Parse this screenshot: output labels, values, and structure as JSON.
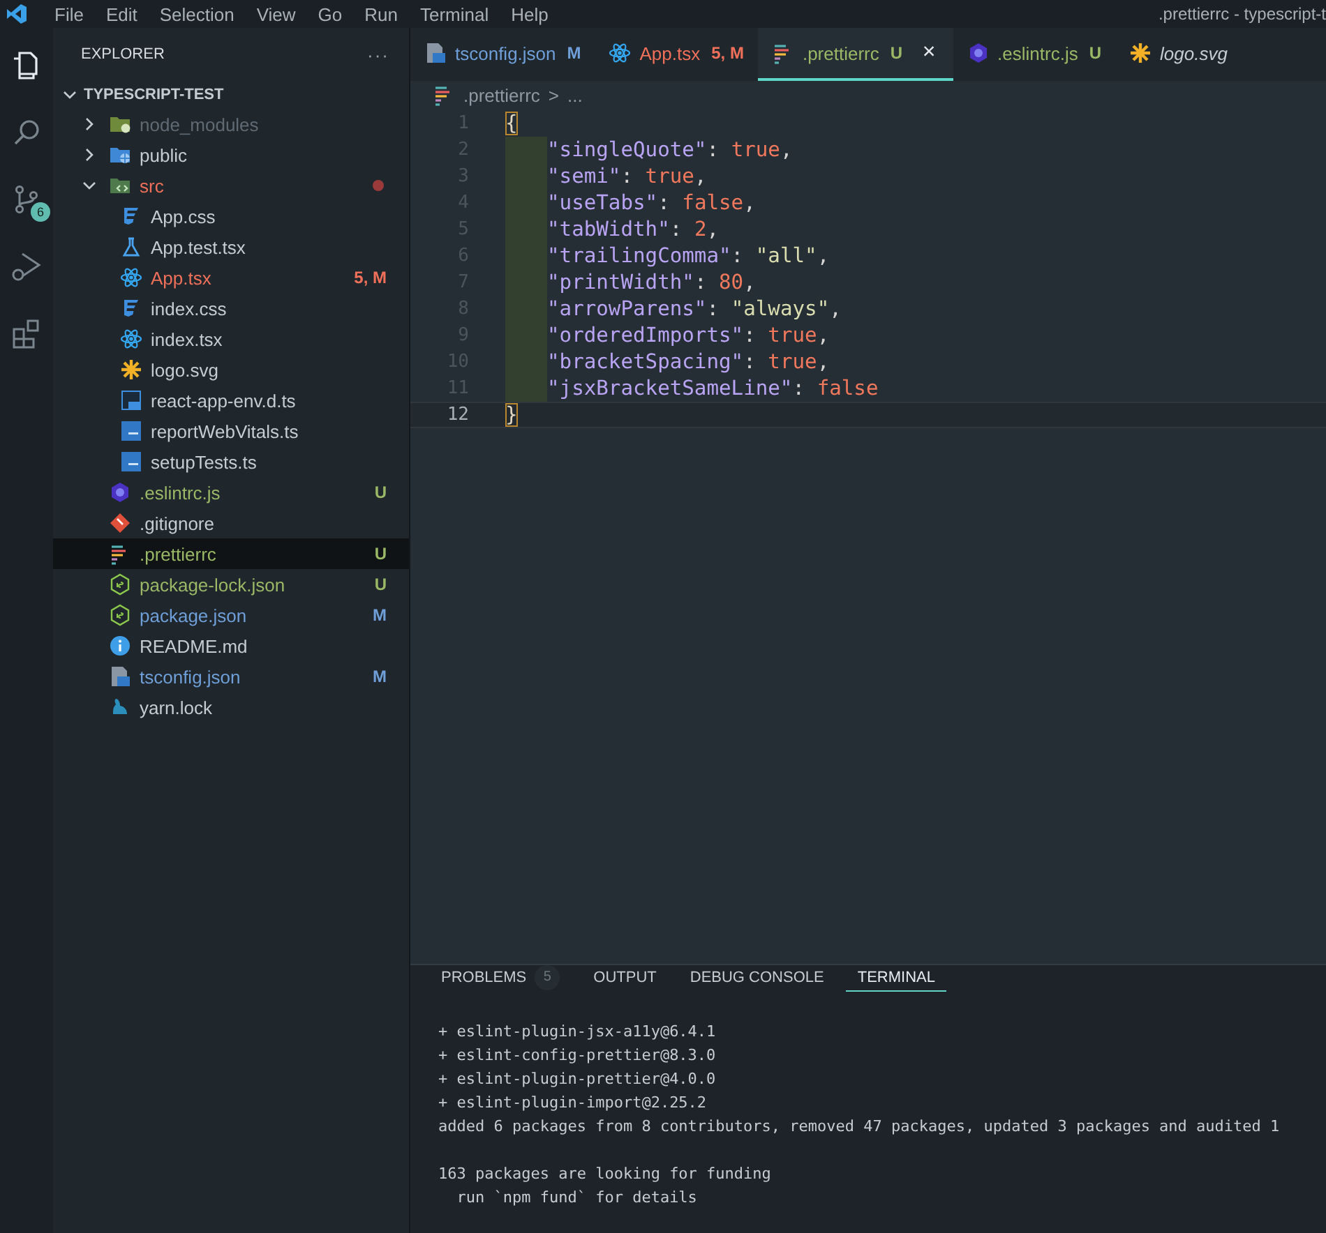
{
  "menu": {
    "items": [
      "File",
      "Edit",
      "Selection",
      "View",
      "Go",
      "Run",
      "Terminal",
      "Help"
    ]
  },
  "window": {
    "title": ".prettierrc - typescript-t"
  },
  "activity_bar": [
    {
      "kind": "explorer",
      "selected": true
    },
    {
      "kind": "search",
      "selected": false
    },
    {
      "kind": "source-control",
      "selected": false,
      "badge": "6"
    },
    {
      "kind": "run-debug",
      "selected": false
    },
    {
      "kind": "extensions",
      "selected": false
    }
  ],
  "sidebar": {
    "title": "EXPLORER",
    "more": "···",
    "root": {
      "label": "TYPESCRIPT-TEST",
      "expanded": true,
      "children": [
        {
          "label": "node_modules",
          "kind": "folder-node",
          "expanded": false,
          "color": "#5f6a73",
          "selected": false
        },
        {
          "label": "public",
          "kind": "folder-public",
          "expanded": false,
          "color": "#c5ccd3",
          "selected": false
        },
        {
          "label": "src",
          "kind": "folder-src",
          "expanded": true,
          "color": "#f0705a",
          "problem_dot": true,
          "selected": false,
          "children": [
            {
              "label": "App.css",
              "kind": "css",
              "color": "#c5ccd3",
              "selected": false
            },
            {
              "label": "App.test.tsx",
              "kind": "test",
              "color": "#c5ccd3",
              "selected": false
            },
            {
              "label": "App.tsx",
              "kind": "react",
              "color": "#f0705a",
              "badge": "5, M",
              "selected": false
            },
            {
              "label": "index.css",
              "kind": "css",
              "color": "#c5ccd3",
              "selected": false
            },
            {
              "label": "index.tsx",
              "kind": "react",
              "color": "#c5ccd3",
              "selected": false
            },
            {
              "label": "logo.svg",
              "kind": "svg",
              "color": "#c5ccd3",
              "selected": false
            },
            {
              "label": "react-app-env.d.ts",
              "kind": "ts-outline",
              "color": "#c5ccd3",
              "selected": false
            },
            {
              "label": "reportWebVitals.ts",
              "kind": "ts",
              "color": "#c5ccd3",
              "selected": false
            },
            {
              "label": "setupTests.ts",
              "kind": "ts",
              "color": "#c5ccd3",
              "selected": false
            }
          ]
        },
        {
          "label": ".eslintrc.js",
          "kind": "eslint",
          "color": "#9ab865",
          "badge": "U",
          "selected": false
        },
        {
          "label": ".gitignore",
          "kind": "git",
          "color": "#c5ccd3",
          "selected": false
        },
        {
          "label": ".prettierrc",
          "kind": "prettier",
          "color": "#9ab865",
          "badge": "U",
          "selected": true
        },
        {
          "label": "package-lock.json",
          "kind": "node",
          "color": "#9ab865",
          "badge": "U",
          "selected": false
        },
        {
          "label": "package.json",
          "kind": "node",
          "color": "#6f9fd8",
          "badge": "M",
          "selected": false
        },
        {
          "label": "README.md",
          "kind": "info",
          "color": "#c5ccd3",
          "selected": false
        },
        {
          "label": "tsconfig.json",
          "kind": "tsconfig",
          "color": "#6f9fd8",
          "badge": "M",
          "selected": false
        },
        {
          "label": "yarn.lock",
          "kind": "yarn",
          "color": "#c5ccd3",
          "selected": false
        }
      ]
    }
  },
  "tabs": [
    {
      "label": "tsconfig.json",
      "kind": "tsconfig",
      "color": "#6f9fd8",
      "badge": "M",
      "selected": false,
      "preview": false
    },
    {
      "label": "App.tsx",
      "kind": "react",
      "color": "#f0705a",
      "badge": "5, M",
      "selected": false,
      "preview": false
    },
    {
      "label": ".prettierrc",
      "kind": "prettier",
      "color": "#9ab865",
      "badge": "U",
      "selected": true,
      "preview": false,
      "close": "×"
    },
    {
      "label": ".eslintrc.js",
      "kind": "eslint",
      "color": "#9ab865",
      "badge": "U",
      "selected": false,
      "preview": false
    },
    {
      "label": "logo.svg",
      "kind": "svg",
      "color": "#c5ccd3",
      "selected": false,
      "preview": true
    }
  ],
  "breadcrumb": {
    "kind": "prettier",
    "file": ".prettierrc",
    "separator": ">",
    "rest": "..."
  },
  "editor": {
    "lines": [
      {
        "number": "1",
        "current": false,
        "indented": false,
        "tokens": [
          {
            "text": "{",
            "kind": "bracket"
          }
        ]
      },
      {
        "number": "2",
        "current": false,
        "indented": true,
        "tokens": [
          {
            "text": "\"singleQuote\"",
            "kind": "key"
          },
          {
            "text": ": ",
            "kind": "punct"
          },
          {
            "text": "true",
            "kind": "literal"
          },
          {
            "text": ",",
            "kind": "punct"
          }
        ]
      },
      {
        "number": "3",
        "current": false,
        "indented": true,
        "tokens": [
          {
            "text": "\"semi\"",
            "kind": "key"
          },
          {
            "text": ": ",
            "kind": "punct"
          },
          {
            "text": "true",
            "kind": "literal"
          },
          {
            "text": ",",
            "kind": "punct"
          }
        ]
      },
      {
        "number": "4",
        "current": false,
        "indented": true,
        "tokens": [
          {
            "text": "\"useTabs\"",
            "kind": "key"
          },
          {
            "text": ": ",
            "kind": "punct"
          },
          {
            "text": "false",
            "kind": "literal"
          },
          {
            "text": ",",
            "kind": "punct"
          }
        ]
      },
      {
        "number": "5",
        "current": false,
        "indented": true,
        "tokens": [
          {
            "text": "\"tabWidth\"",
            "kind": "key"
          },
          {
            "text": ": ",
            "kind": "punct"
          },
          {
            "text": "2",
            "kind": "literal"
          },
          {
            "text": ",",
            "kind": "punct"
          }
        ]
      },
      {
        "number": "6",
        "current": false,
        "indented": true,
        "tokens": [
          {
            "text": "\"trailingComma\"",
            "kind": "key"
          },
          {
            "text": ": ",
            "kind": "punct"
          },
          {
            "text": "\"all\"",
            "kind": "string"
          },
          {
            "text": ",",
            "kind": "punct"
          }
        ]
      },
      {
        "number": "7",
        "current": false,
        "indented": true,
        "tokens": [
          {
            "text": "\"printWidth\"",
            "kind": "key"
          },
          {
            "text": ": ",
            "kind": "punct"
          },
          {
            "text": "80",
            "kind": "literal"
          },
          {
            "text": ",",
            "kind": "punct"
          }
        ]
      },
      {
        "number": "8",
        "current": false,
        "indented": true,
        "tokens": [
          {
            "text": "\"arrowParens\"",
            "kind": "key"
          },
          {
            "text": ": ",
            "kind": "punct"
          },
          {
            "text": "\"always\"",
            "kind": "string"
          },
          {
            "text": ",",
            "kind": "punct"
          }
        ]
      },
      {
        "number": "9",
        "current": false,
        "indented": true,
        "tokens": [
          {
            "text": "\"orderedImports\"",
            "kind": "key"
          },
          {
            "text": ": ",
            "kind": "punct"
          },
          {
            "text": "true",
            "kind": "literal"
          },
          {
            "text": ",",
            "kind": "punct"
          }
        ]
      },
      {
        "number": "10",
        "current": false,
        "indented": true,
        "tokens": [
          {
            "text": "\"bracketSpacing\"",
            "kind": "key"
          },
          {
            "text": ": ",
            "kind": "punct"
          },
          {
            "text": "true",
            "kind": "literal"
          },
          {
            "text": ",",
            "kind": "punct"
          }
        ]
      },
      {
        "number": "11",
        "current": false,
        "indented": true,
        "tokens": [
          {
            "text": "\"jsxBracketSameLine\"",
            "kind": "key"
          },
          {
            "text": ": ",
            "kind": "punct"
          },
          {
            "text": "false",
            "kind": "literal"
          }
        ]
      },
      {
        "number": "12",
        "current": true,
        "indented": false,
        "tokens": [
          {
            "text": "}",
            "kind": "bracket"
          }
        ]
      }
    ]
  },
  "panel": {
    "tabs": [
      {
        "label": "PROBLEMS",
        "count": "5",
        "selected": false
      },
      {
        "label": "OUTPUT",
        "selected": false
      },
      {
        "label": "DEBUG CONSOLE",
        "selected": false
      },
      {
        "label": "TERMINAL",
        "selected": true
      }
    ],
    "terminal": [
      [
        "+ eslint-plugin-jsx-a11y@6.4.1",
        "+ eslint-config-prettier@8.3.0",
        "+ eslint-plugin-prettier@4.0.0",
        "+ eslint-plugin-import@2.25.2",
        "added 6 packages from 8 contributors, removed 47 packages, updated 3 packages and audited 1"
      ],
      [
        "163 packages are looking for funding",
        "  run `npm fund` for details"
      ]
    ]
  }
}
